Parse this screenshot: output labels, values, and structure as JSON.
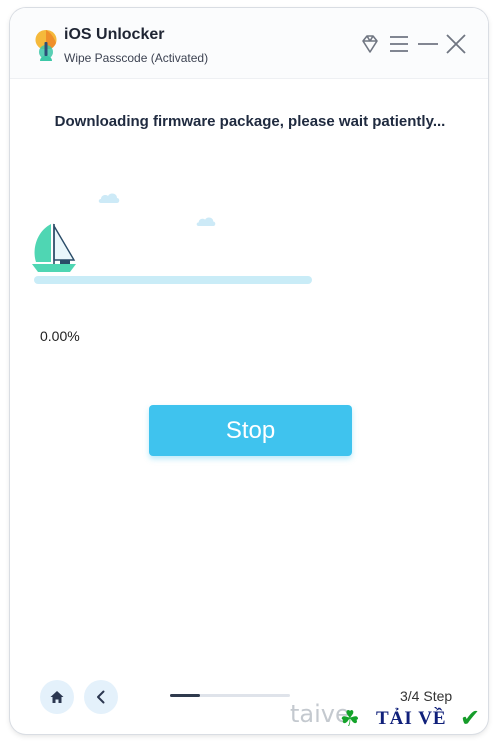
{
  "app": {
    "title": "iOS Unlocker",
    "subtitle": "Wipe Passcode  (Activated)"
  },
  "window_controls": [
    "diamond-icon",
    "menu-icon",
    "minimize-icon",
    "close-icon"
  ],
  "main": {
    "heading": "Downloading firmware package, please wait patiently...",
    "progress": 0.0,
    "progress_text": "0.00%",
    "stop_label": "Stop"
  },
  "footer": {
    "home_icon": "home-icon",
    "back_icon": "chevron-left-icon",
    "step_progress": 0.25,
    "step_text": "3/4 Step"
  },
  "watermark": {
    "left_text": "taive",
    "brand_text": "TẢI VỀ"
  },
  "colors": {
    "accent": "#3fc3ee",
    "progress_track": "#c9ecf7",
    "title_text": "#1f2533",
    "boat_sail": "#4fd6b3"
  }
}
